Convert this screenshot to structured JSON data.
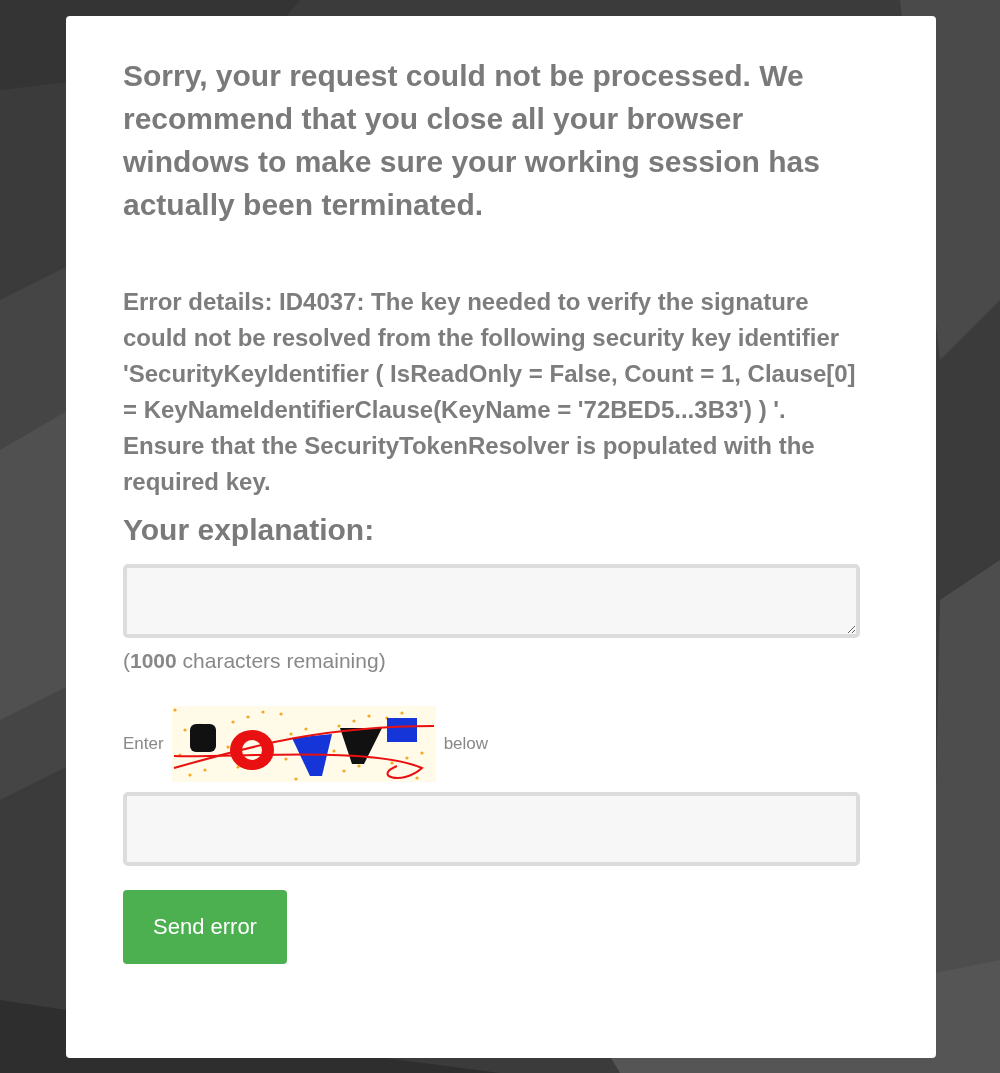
{
  "message": "Sorry, your request could not be processed. We recommend that you close all your browser windows to make sure your working session has actually been terminated.",
  "error_details": "Error details: ID4037: The key needed to verify the signature could not be resolved from the following security key identifier 'SecurityKeyIdentifier ( IsReadOnly = False, Count = 1, Clause[0] = KeyNameIdentifierClause(KeyName = '72BED5...3B3') ) '. Ensure that the SecurityTokenResolver is populated with the required key.",
  "explanation": {
    "label": "Your explanation:",
    "remaining": "(**1000** characters remaining)"
  },
  "captcha": {
    "before": "Enter",
    "after": "below"
  },
  "send_button": "Send error"
}
